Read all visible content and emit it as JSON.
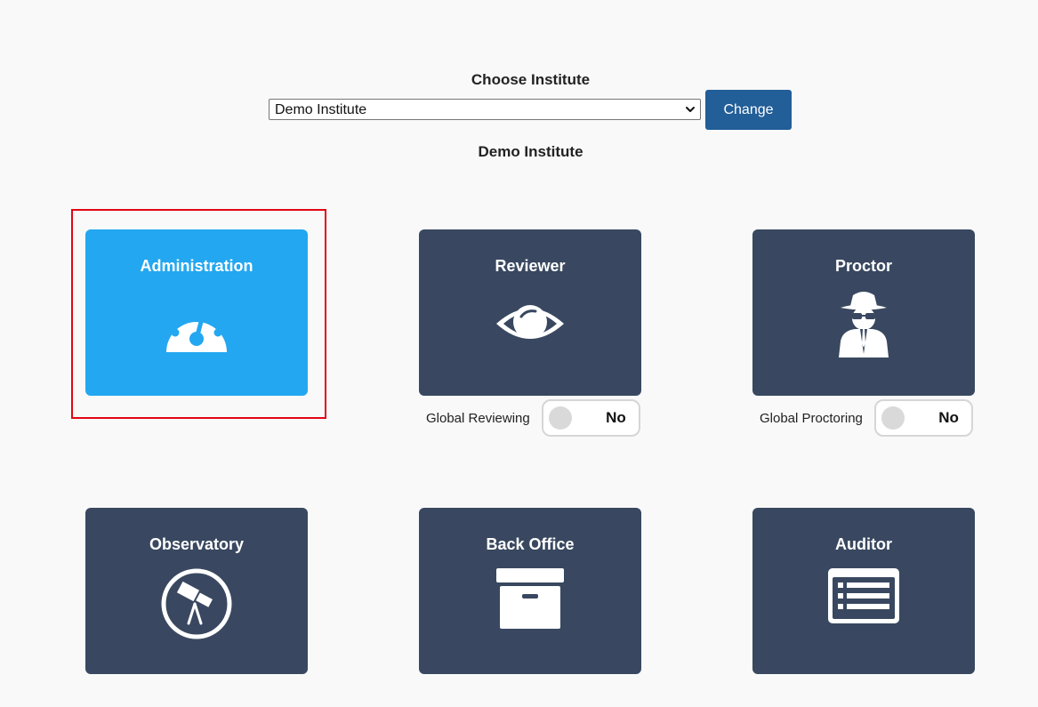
{
  "chooser": {
    "title": "Choose Institute",
    "selected": "Demo Institute",
    "change_label": "Change"
  },
  "institute_name": "Demo Institute",
  "tiles": [
    {
      "label": "Administration",
      "icon": "dashboard-gauge-icon",
      "active": true
    },
    {
      "label": "Reviewer",
      "icon": "eye-icon"
    },
    {
      "label": "Proctor",
      "icon": "spy-icon"
    },
    {
      "label": "Observatory",
      "icon": "telescope-icon"
    },
    {
      "label": "Back Office",
      "icon": "archive-box-icon"
    },
    {
      "label": "Auditor",
      "icon": "list-card-icon"
    }
  ],
  "toggles": {
    "reviewing": {
      "label": "Global Reviewing",
      "value": "No"
    },
    "proctoring": {
      "label": "Global Proctoring",
      "value": "No"
    }
  },
  "colors": {
    "tile_default": "#394860",
    "tile_active": "#23a7f1",
    "change_button": "#225e98",
    "selection_frame": "#e30613",
    "background": "#f9f9f9"
  }
}
